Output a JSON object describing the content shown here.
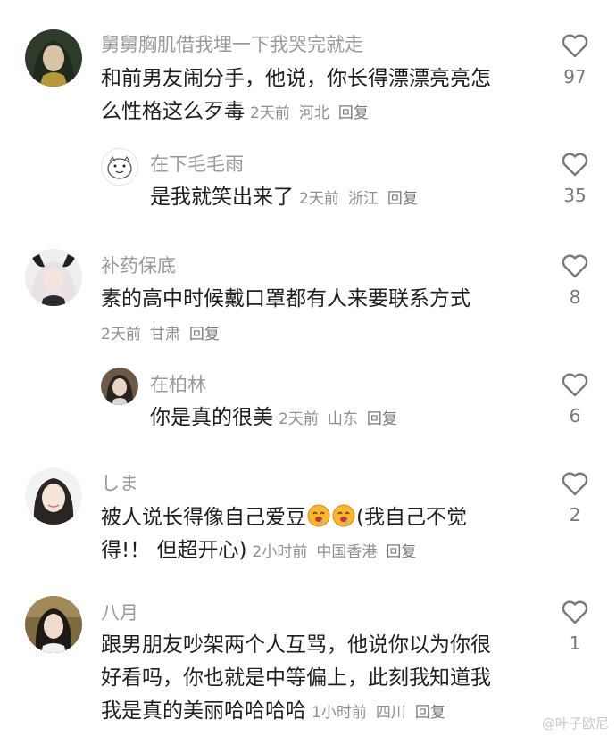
{
  "comments": [
    {
      "username": "舅舅胸肌借我埋一下我哭完就走",
      "lines": [
        "和前男友闹分手，他说，你长得漂漂亮亮怎",
        "么性格这么歹毒"
      ],
      "time": "2天前",
      "location": "河北",
      "reply": "回复",
      "likes": "97"
    },
    {
      "username": "在下毛毛雨",
      "lines": [
        "是我就笑出来了"
      ],
      "time": "2天前",
      "location": "浙江",
      "reply": "回复",
      "likes": "35"
    },
    {
      "username": "补药保底",
      "lines": [
        "素的高中时候戴口罩都有人来要联系方式"
      ],
      "time": "2天前",
      "location": "甘肃",
      "reply": "回复",
      "likes": "8"
    },
    {
      "username": "在柏林",
      "lines": [
        "你是真的很美"
      ],
      "time": "2天前",
      "location": "山东",
      "reply": "回复",
      "likes": "6"
    },
    {
      "username": "しま",
      "line1_text": "被人说长得像自己爱豆",
      "line1_after": "(我自己不觉",
      "line2": "得!！ 但超开心)",
      "time": "2小时前",
      "location": "中国香港",
      "reply": "回复",
      "likes": "2"
    },
    {
      "username": "八月",
      "lines": [
        "跟男朋友吵架两个人互骂，他说你以为你很",
        "好看吗，你也就是中等偏上，此刻我知道我",
        "我是真的美丽哈哈哈哈"
      ],
      "time": "1小时前",
      "location": "四川",
      "reply": "回复",
      "likes": "1"
    }
  ],
  "watermark": "@叶子欧尼",
  "colors": {
    "text": "#1e1e1e",
    "username": "#9a9a9a",
    "meta": "#8f8f8f",
    "heart": "#7a7a7a"
  },
  "icons": {
    "like": "heart-outline-icon",
    "emoji": "drooling-face-emoji"
  }
}
